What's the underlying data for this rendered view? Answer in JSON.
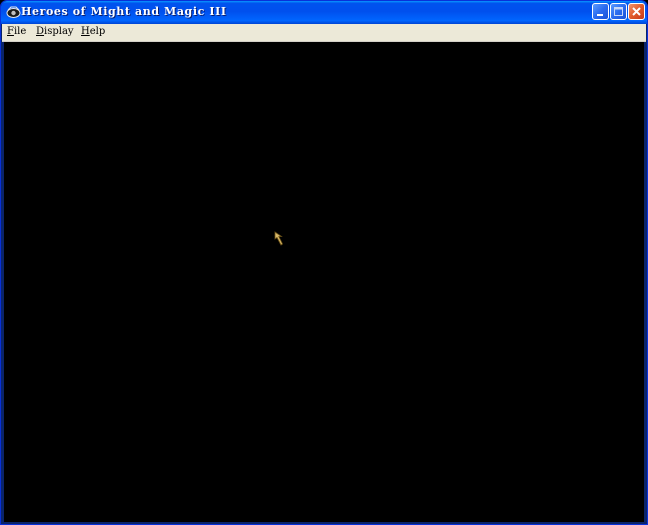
{
  "window": {
    "title": "Heroes of Might and Magic III",
    "icon": "game-eye-icon"
  },
  "titlebar_buttons": [
    {
      "name": "minimize",
      "icon": "minimize-icon"
    },
    {
      "name": "maximize",
      "icon": "maximize-icon"
    },
    {
      "name": "close",
      "icon": "close-icon"
    }
  ],
  "menu": {
    "file": {
      "accel": "F",
      "rest": "ile"
    },
    "display": {
      "accel": "D",
      "rest": "isplay"
    },
    "help": {
      "accel": "H",
      "rest": "elp"
    }
  },
  "colors": {
    "titlebar": "#0054E3",
    "menubar": "#ECE9D8",
    "client": "#000000",
    "cursor": "#D8B868",
    "close_button": "#E15B2A"
  }
}
